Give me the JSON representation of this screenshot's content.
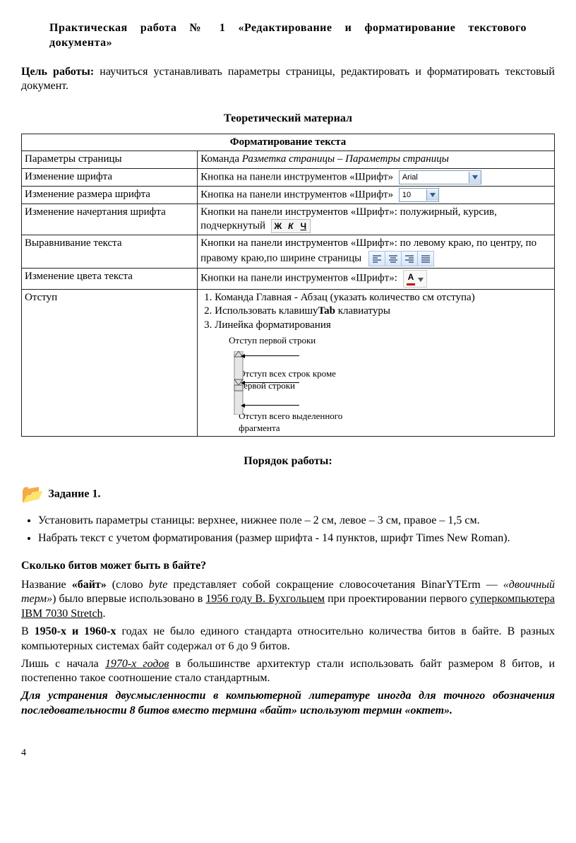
{
  "title": "Практическая  работа  №  1  «Редактирование  и  форматирование текстового документа»",
  "goal_label": "Цель работы:",
  "goal_text": " научиться устанавливать параметры страницы, редактировать и форматировать текстовый документ.",
  "section1": "Теоретический материал",
  "table_header": "Форматирование текста",
  "rows": {
    "r1c1": "Параметры страницы",
    "r1c2a": "Команда ",
    "r1c2b": "Разметка страницы – Параметры страницы",
    "r2c1": "Изменение шрифта",
    "r2c2": "Кнопка на панели инструментов «Шрифт»",
    "r3c1": "Изменение размера шрифта",
    "r3c2": "Кнопка на панели инструментов «Шрифт»",
    "r4c1": "Изменение начертания шрифта",
    "r4c2a": "Кнопки на панели инструментов «Шрифт»: полужирный, курсив, подчеркнутый",
    "r5c1": "Выравнивание текста",
    "r5c2": "Кнопки на панели инструментов «Шрифт»: по левому краю, по центру, по правому краю,по ширине страницы",
    "r6c1": "Изменение цвета текста",
    "r6c2": "Кнопки на панели инструментов «Шрифт»:",
    "r7c1": "Отступ",
    "r7li1": "Команда Главная - Абзац (указать количество см отступа)",
    "r7li2_a": "Использовать клавишу",
    "r7li2_b": "Tab",
    "r7li2_c": " клавиатуры",
    "r7li3": "Линейка форматирования",
    "r7note1": "Отступ первой строки",
    "r7note2": "Отступ всех строк кроме первой строки",
    "r7note3": "Отступ всего выделенного фрагмента"
  },
  "dd_font_value": "Arial",
  "dd_size_value": "10",
  "bui_b": "Ж",
  "bui_i": "К",
  "bui_u": "Ч",
  "fontcolor_a": "А",
  "section2": "Порядок работы:",
  "task1_label": "Задание 1.",
  "bullets": {
    "b1": "Установить параметры станицы: верхнее, нижнее поле – 2 см, левое – 3 см, правое – 1,5 см.",
    "b2": "Набрать текст с учетом форматирования (размер шрифта - 14 пунктов, шрифт Times New Roman)."
  },
  "question": "Сколько битов может быть в байте?",
  "p1": {
    "a": "Название ",
    "b": "«байт»",
    "c": " (слово ",
    "d": "byte",
    "e": " представляет собой сокращение словосочетания BinarYTErm — ",
    "f": "«двоичный терм»",
    "g": ") было впервые использовано в ",
    "h": "1956",
    "i": " году В.",
    "j": " Бухгольцем",
    "k": " при проектировании первого ",
    "l": "суперкомпьютера",
    "m": " IBM 7030 Stretch",
    "n": "."
  },
  "p2": {
    "a": "В ",
    "b": "1950-х и 1960-х",
    "c": " годах не было единого стандарта относительно количества битов в байте. В разных компьютерных системах байт содержал от 6 до 9 битов."
  },
  "p3": {
    "a": "Лишь с начала ",
    "b": "1970-х годов",
    "c": " в большинстве архитектур стали использовать байт размером 8 битов, и постепенно такое соотношение стало стандартным."
  },
  "p4": "Для устранения двусмысленности в компьютерной литературе иногда для точного обозначения последовательности 8 битов вместо термина «байт» используют термин «октет».",
  "page_number": "4"
}
